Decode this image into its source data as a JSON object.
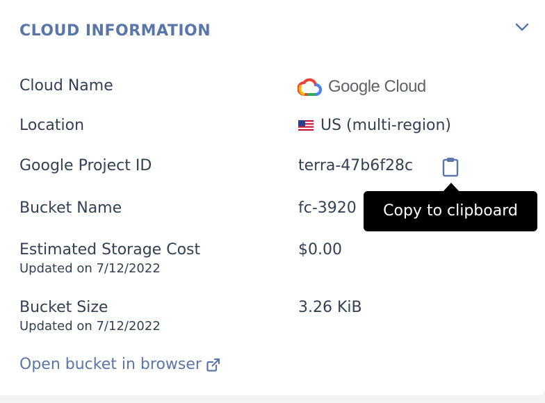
{
  "section": {
    "title": "CLOUD INFORMATION"
  },
  "rows": {
    "cloud_name": {
      "label": "Cloud Name",
      "value": "Google Cloud"
    },
    "location": {
      "label": "Location",
      "value": "US (multi-region)"
    },
    "project_id": {
      "label": "Google Project ID",
      "value": "terra-47b6f28c"
    },
    "bucket_name": {
      "label": "Bucket Name",
      "value": "fc-3920"
    },
    "storage_cost": {
      "label": "Estimated Storage Cost",
      "updated": "Updated on 7/12/2022",
      "value": "$0.00"
    },
    "bucket_size": {
      "label": "Bucket Size",
      "updated": "Updated on 7/12/2022",
      "value": "3.26 KiB"
    }
  },
  "tooltip": {
    "text": "Copy to clipboard"
  },
  "link": {
    "label": "Open bucket in browser"
  },
  "icons": {
    "collapse": "chevron-down-icon",
    "logo": "google-cloud-logo-icon",
    "flag": "us-flag-icon",
    "copy": "clipboard-icon",
    "external": "external-link-icon"
  },
  "colors": {
    "accent": "#5a76a8",
    "text": "#333f52",
    "tooltip_bg": "#000000"
  }
}
